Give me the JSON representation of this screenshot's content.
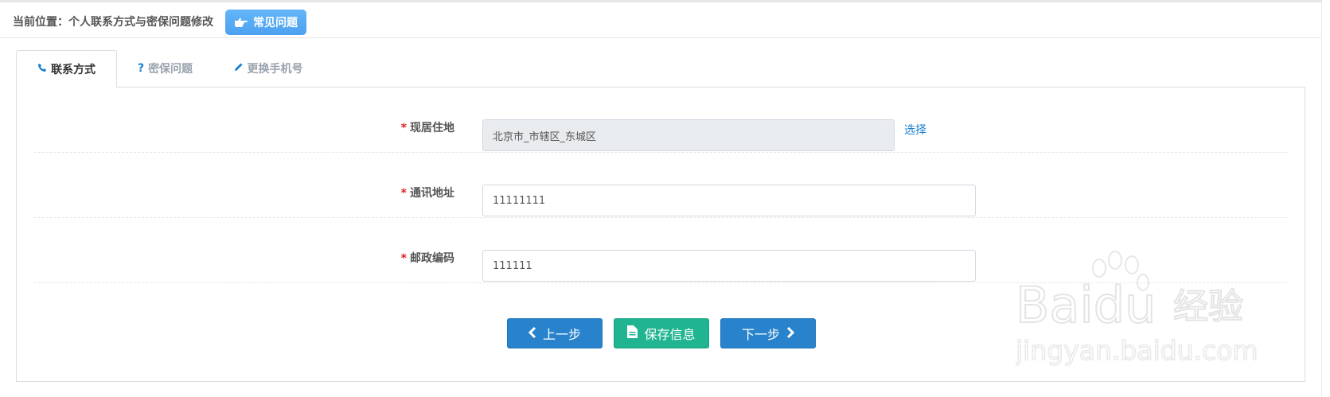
{
  "breadcrumb": {
    "text": "当前位置：个人联系方式与密保问题修改"
  },
  "faq_button": {
    "label": "常见问题",
    "icon": "pointing-hand-icon"
  },
  "tabs": [
    {
      "label": "联系方式",
      "icon": "phone-icon",
      "active": true
    },
    {
      "label": "密保问题",
      "icon": "question-icon",
      "active": false
    },
    {
      "label": "更换手机号",
      "icon": "pencil-icon",
      "active": false
    }
  ],
  "form": {
    "required_mark": "*",
    "residence": {
      "label": "现居住地",
      "value": "北京市_市辖区_东城区",
      "action": "选择"
    },
    "address": {
      "label": "通讯地址",
      "value": "11111111"
    },
    "postcode": {
      "label": "邮政编码",
      "value": "111111"
    }
  },
  "buttons": {
    "prev": {
      "label": "上一步",
      "icon": "chevron-left-icon"
    },
    "save": {
      "label": "保存信息",
      "icon": "document-icon"
    },
    "next": {
      "label": "下一步",
      "icon": "chevron-right-icon"
    }
  },
  "watermark": {
    "brand": "Baidu",
    "brand_cn": "经验",
    "url": "jingyan.baidu.com"
  },
  "colors": {
    "primary": "#2883cc",
    "success": "#21b491",
    "faq": "#4da1f0",
    "link": "#1a7fd0",
    "required": "#e02020",
    "readonly_bg": "#e9ecef"
  }
}
